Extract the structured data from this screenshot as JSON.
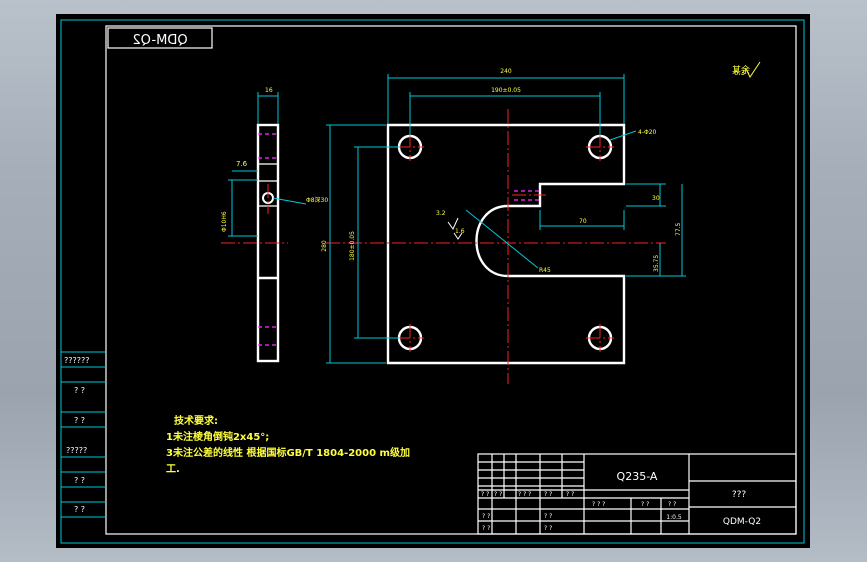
{
  "drawing": {
    "code": "QDM-Q2",
    "roughness_symbol": "6.3",
    "tech_requirements": {
      "title": "技术要求:",
      "line1": "1未注棱角倒钝2x45°;",
      "line2": "3未注公差的线性 根据国标GB/T 1804-2000 m级加",
      "line3": "工."
    }
  },
  "dimensions": {
    "side_top_width": "16",
    "side_offset": "7.6",
    "side_hole": "Φ8深30",
    "side_vertical": "Φ10H6",
    "side_total_height": "280",
    "overall_width": "240",
    "hole_spacing_x": "190±0.05",
    "hole_spacing_y": "180±0.05",
    "holes_callout": "4-Φ20",
    "slot_width": "30",
    "slot_length": "70",
    "slot_offset_a": "77.5",
    "slot_offset_b": "35.75",
    "slot_radius": "R45",
    "roughness_a": "3.2",
    "roughness_b": "1.6"
  },
  "title_block": {
    "material": "Q235-A",
    "drawing_name": "???",
    "drawing_code": "QDM-Q2",
    "scale": "1:0.5",
    "cells": {
      "c1": "? ?",
      "c2": "? ?",
      "c3": "? ? ?",
      "c4": "? ?",
      "c5": "? ?",
      "c6": "? ?",
      "c7": "? ?",
      "c8": "? ?",
      "c9": "? ?",
      "c10": "? ? ?",
      "c11": "? ?",
      "c12": "? ?"
    }
  },
  "side_panel": {
    "labels": [
      "??????",
      "? ?",
      "? ?",
      "?????",
      "? ?",
      "? ?"
    ]
  }
}
